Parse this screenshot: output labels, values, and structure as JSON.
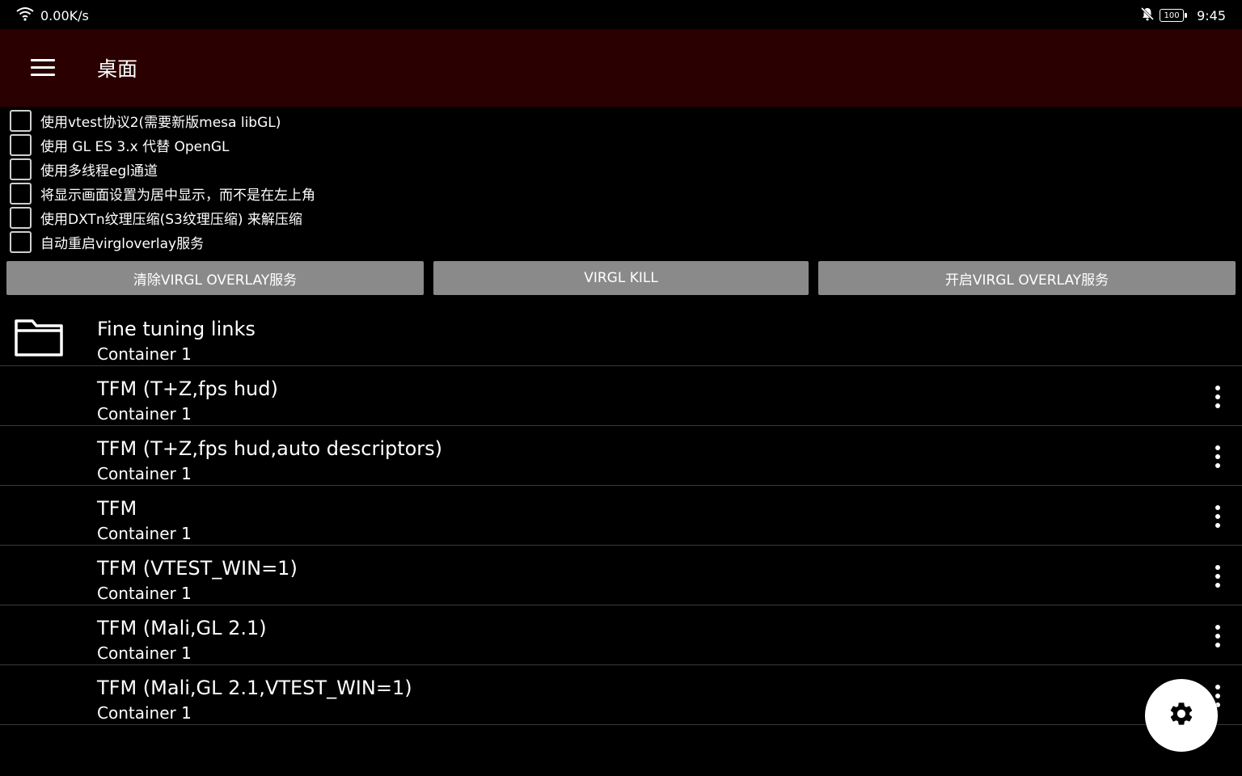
{
  "status_bar": {
    "net_speed": "0.00K/s",
    "battery": "100",
    "time": "9:45",
    "icons": [
      "wifi-icon",
      "mute-bell-icon",
      "battery-icon"
    ]
  },
  "app_bar": {
    "title": "桌面"
  },
  "options": [
    {
      "label": "使用vtest协议2(需要新版mesa libGL)",
      "checked": false
    },
    {
      "label": "使用 GL ES 3.x 代替 OpenGL",
      "checked": false
    },
    {
      "label": "使用多线程egl通道",
      "checked": false
    },
    {
      "label": "将显示画面设置为居中显示，而不是在左上角",
      "checked": false
    },
    {
      "label": "使用DXTn纹理压缩(S3纹理压缩) 来解压缩",
      "checked": false
    },
    {
      "label": "自动重启virgloverlay服务",
      "checked": false
    }
  ],
  "buttons": {
    "clear": "清除VIRGL OVERLAY服务",
    "kill": "VIRGL KILL",
    "start": "开启VIRGL OVERLAY服务"
  },
  "list": [
    {
      "title": "Fine tuning links",
      "subtitle": "Container 1",
      "icon": "folder-icon"
    },
    {
      "title": "TFM (T+Z,fps hud)",
      "subtitle": "Container 1"
    },
    {
      "title": "TFM (T+Z,fps hud,auto descriptors)",
      "subtitle": "Container 1"
    },
    {
      "title": "TFM",
      "subtitle": "Container 1"
    },
    {
      "title": "TFM (VTEST_WIN=1)",
      "subtitle": "Container 1"
    },
    {
      "title": "TFM (Mali,GL 2.1)",
      "subtitle": "Container 1"
    },
    {
      "title": "TFM (Mali,GL 2.1,VTEST_WIN=1)",
      "subtitle": "Container 1"
    }
  ],
  "fab": {
    "icon": "gear-icon"
  },
  "colors": {
    "app_bar_bg": "#2a0000",
    "button_bg": "#8a8a8a",
    "background": "#000000"
  }
}
